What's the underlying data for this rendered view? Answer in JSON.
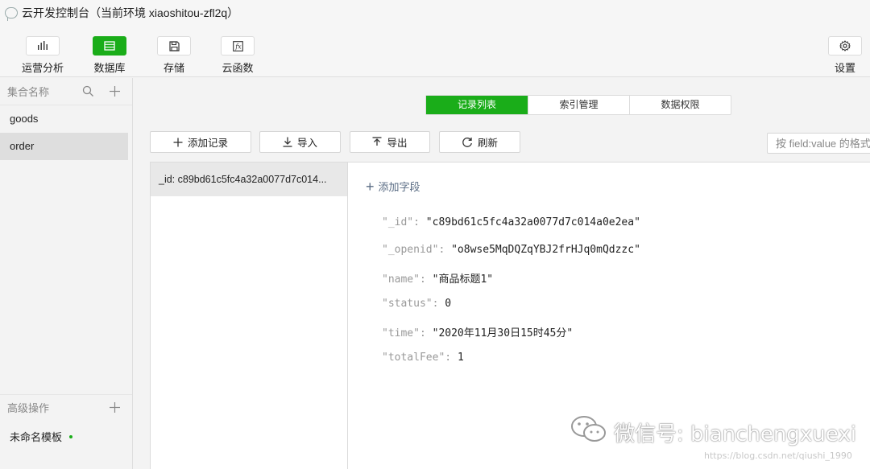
{
  "window": {
    "title": "云开发控制台（当前环境 xiaoshitou-zfl2q）",
    "app_icon": "wechat-devtools-icon"
  },
  "toolbar": {
    "items": [
      {
        "label": "运营分析",
        "icon": "bar-chart-icon",
        "active": false
      },
      {
        "label": "数据库",
        "icon": "database-icon",
        "active": true
      },
      {
        "label": "存储",
        "icon": "save-icon",
        "active": false
      },
      {
        "label": "云函数",
        "icon": "function-icon",
        "active": false
      }
    ],
    "settings": {
      "label": "设置",
      "icon": "gear-icon"
    }
  },
  "sidebar": {
    "header": "集合名称",
    "collections": [
      {
        "name": "goods",
        "selected": false
      },
      {
        "name": "order",
        "selected": true
      }
    ],
    "advanced_header": "高级操作",
    "advanced_items": [
      {
        "label": "未命名模板",
        "status": "active"
      }
    ]
  },
  "tabs": [
    {
      "label": "记录列表",
      "active": true
    },
    {
      "label": "索引管理",
      "active": false
    },
    {
      "label": "数据权限",
      "active": false
    }
  ],
  "actions": {
    "add_record": "添加记录",
    "import": "导入",
    "export": "导出",
    "refresh": "刷新"
  },
  "search": {
    "placeholder": "按 field:value 的格式"
  },
  "records": [
    {
      "label": "_id: c89bd61c5fc4a32a0077d7c014..."
    }
  ],
  "detail": {
    "add_field": "添加字段",
    "fields": [
      {
        "key": "\"_id\"",
        "value": "\"c89bd61c5fc4a32a0077d7c014a0e2ea\""
      },
      {
        "key": "\"_openid\"",
        "value": "\"o8wse5MqDQZqYBJ2frHJq0mQdzzc\""
      },
      {
        "key": "\"name\"",
        "value": "\"商品标题1\""
      },
      {
        "key": "\"status\"",
        "value": "0"
      },
      {
        "key": "\"time\"",
        "value": "\"2020年11月30日15时45分\""
      },
      {
        "key": "\"totalFee\"",
        "value": "1"
      }
    ]
  },
  "watermark": {
    "text": "微信号: bianchengxuexi",
    "url": "https://blog.csdn.net/qiushi_1990"
  },
  "colors": {
    "accent": "#1aad19",
    "key_text": "#999999",
    "link_text": "#5a6c84"
  }
}
